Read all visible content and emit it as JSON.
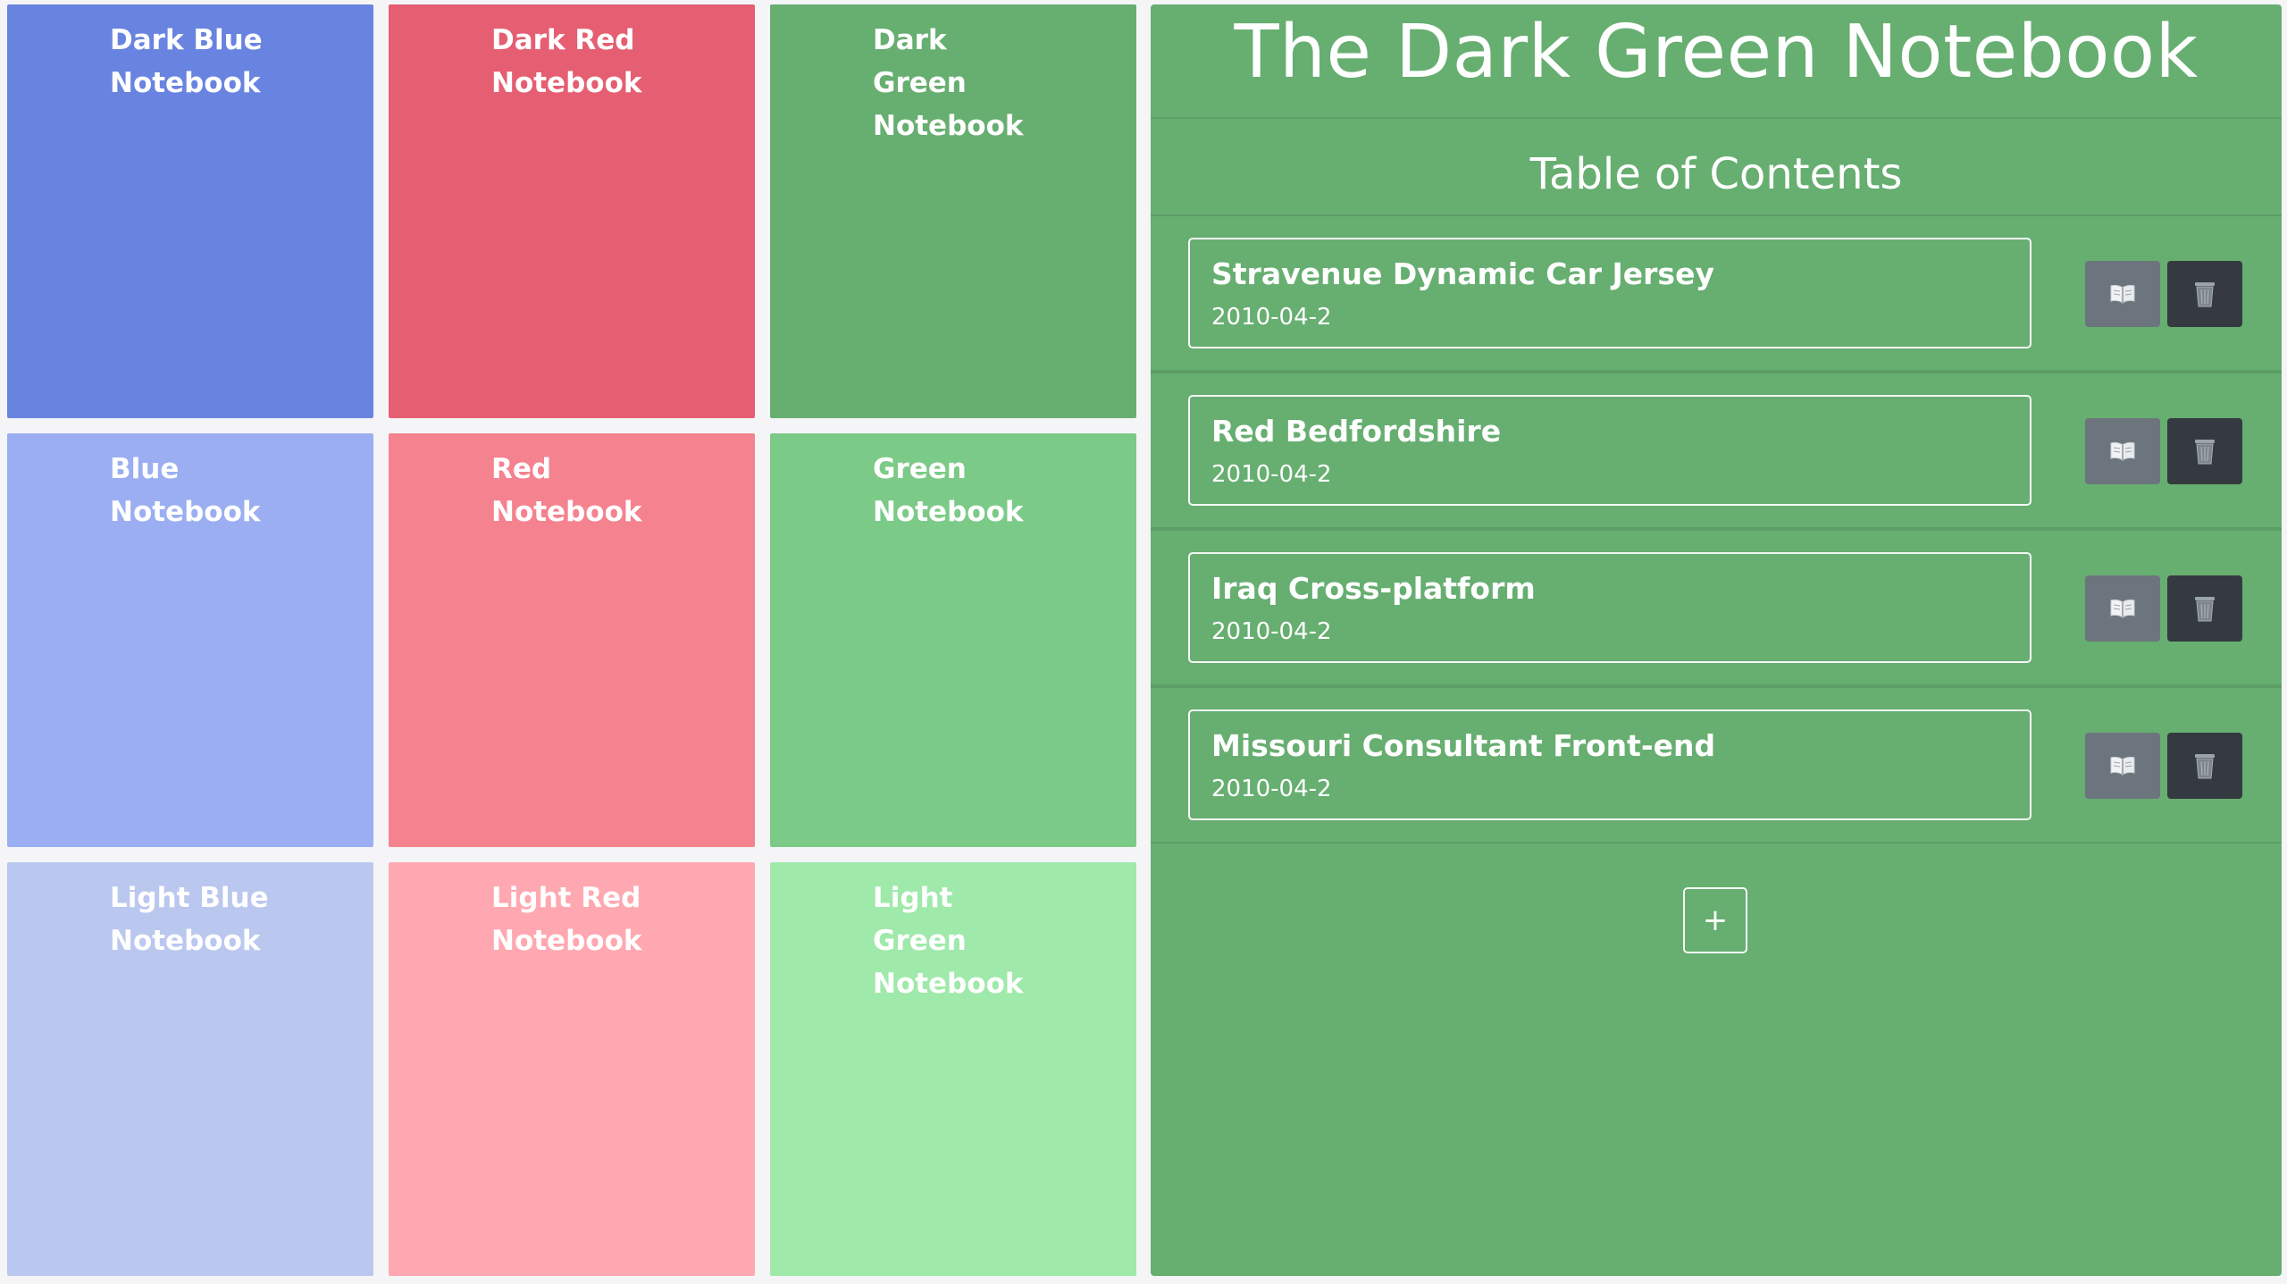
{
  "notebooks": [
    {
      "title": "Dark Blue Notebook",
      "color": "#6884e0"
    },
    {
      "title": "Dark Red Notebook",
      "color": "#e55e72"
    },
    {
      "title": "Dark Green Notebook",
      "color": "#67ae71"
    },
    {
      "title": "Blue Notebook",
      "color": "#9aaef1"
    },
    {
      "title": "Red Notebook",
      "color": "#f5828f"
    },
    {
      "title": "Green Notebook",
      "color": "#7cca88"
    },
    {
      "title": "Light Blue Notebook",
      "color": "#bac7ee"
    },
    {
      "title": "Light Red Notebook",
      "color": "#ffa8b1"
    },
    {
      "title": "Light Green Notebook",
      "color": "#9fe9aa"
    }
  ],
  "panel": {
    "title": "The Dark Green Notebook",
    "toc_title": "Table of Contents",
    "entries": [
      {
        "name": "Stravenue Dynamic Car Jersey",
        "date": "2010-04-2"
      },
      {
        "name": "Red Bedfordshire",
        "date": "2010-04-2"
      },
      {
        "name": "Iraq Cross-platform",
        "date": "2010-04-2"
      },
      {
        "name": "Missouri Consultant Front-end",
        "date": "2010-04-2"
      }
    ],
    "add_label": "+",
    "read_icon": "open-book-icon",
    "delete_icon": "trash-icon"
  }
}
